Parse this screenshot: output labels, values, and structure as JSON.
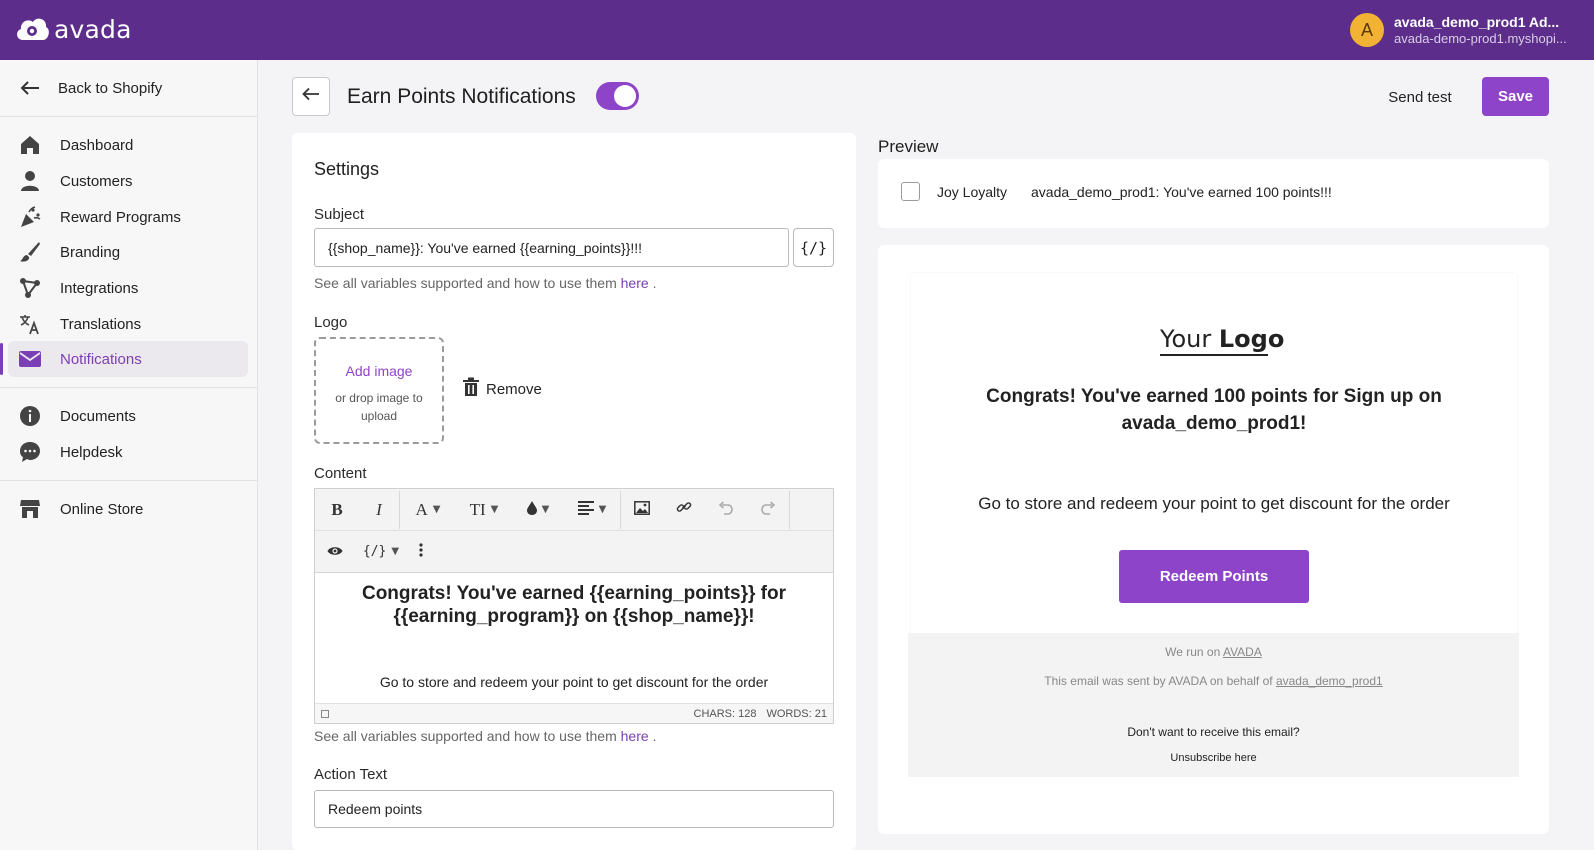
{
  "app": {
    "brand": "avada",
    "account_initial": "A",
    "account_name": "avada_demo_prod1 Ad...",
    "account_domain": "avada-demo-prod1.myshopi...",
    "brand_color": "#5c2d8a",
    "accent_color": "#8e44c9"
  },
  "sidebar": {
    "back_label": "Back to Shopify",
    "items": [
      {
        "label": "Dashboard",
        "icon": "home-icon"
      },
      {
        "label": "Customers",
        "icon": "person-icon"
      },
      {
        "label": "Reward Programs",
        "icon": "confetti-icon"
      },
      {
        "label": "Branding",
        "icon": "brush-icon"
      },
      {
        "label": "Integrations",
        "icon": "integrations-icon"
      },
      {
        "label": "Translations",
        "icon": "translate-icon"
      },
      {
        "label": "Notifications",
        "icon": "mail-icon",
        "active": true
      }
    ],
    "secondary": [
      {
        "label": "Documents",
        "icon": "info-icon"
      },
      {
        "label": "Helpdesk",
        "icon": "chat-icon"
      }
    ],
    "store": {
      "label": "Online Store",
      "icon": "store-icon"
    }
  },
  "header": {
    "title": "Earn Points Notifications",
    "enabled": true,
    "send_test_label": "Send test",
    "save_label": "Save"
  },
  "settings": {
    "title": "Settings",
    "subject_label": "Subject",
    "subject_value": "{{shop_name}}: You've earned {{earning_points}}!!!",
    "variables_button": "{/}",
    "help_text": "See all variables supported and how to use them",
    "help_link": "here",
    "help_period": ".",
    "logo_label": "Logo",
    "add_image": "Add image",
    "drop_hint": "or drop image to upload",
    "remove_label": "Remove",
    "content_label": "Content",
    "editor": {
      "bold": "B",
      "italic": "I",
      "font": "A",
      "size": "TI",
      "heading": "Congrats! You've earned {{earning_points}} for {{earning_program}} on {{shop_name}}!",
      "body": "Go to store and redeem your point to get discount for the order",
      "chars": "CHARS: 128",
      "words": "WORDS: 21"
    },
    "action_text_label": "Action Text",
    "action_text_value": "Redeem points"
  },
  "preview": {
    "title": "Preview",
    "sender": "Joy Loyalty",
    "subject": "avada_demo_prod1: You've earned 100 points!!!",
    "logo_your": "Your",
    "logo_logo": "Logo",
    "heading": "Congrats! You've earned 100 points for Sign up on avada_demo_prod1!",
    "body": "Go to store and redeem your point to get discount for the order",
    "cta": "Redeem Points",
    "footer_run_prefix": "We run on",
    "footer_run_link": "AVADA",
    "footer_sent_prefix": "This email was sent by AVADA on behalf of",
    "footer_sent_link": "avada_demo_prod1",
    "footer_question": "Don't want to receive this email?",
    "footer_unsubscribe": "Unsubscribe here"
  }
}
